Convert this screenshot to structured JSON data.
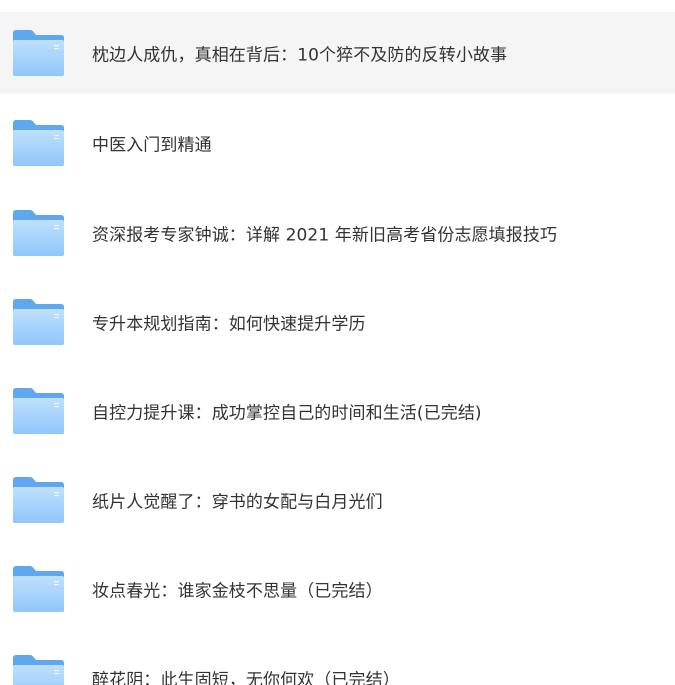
{
  "colors": {
    "folder_back": "#5fa7ee",
    "folder_front_top": "#bfe0fd",
    "folder_front_bottom": "#8fc6fa",
    "text": "#333333",
    "hover_bg": "#f5f5f6"
  },
  "files": [
    {
      "name": "枕边人成仇，真相在背后：10个猝不及防的反转小故事",
      "icon": "folder-icon",
      "hovered": true
    },
    {
      "name": "中医入门到精通",
      "icon": "folder-icon"
    },
    {
      "name": "资深报考专家钟诚：详解 2021 年新旧高考省份志愿填报技巧",
      "icon": "folder-icon"
    },
    {
      "name": "专升本规划指南：如何快速提升学历",
      "icon": "folder-icon"
    },
    {
      "name": "自控力提升课：成功掌控自己的时间和生活(已完结)",
      "icon": "folder-icon"
    },
    {
      "name": "纸片人觉醒了：穿书的女配与白月光们",
      "icon": "folder-icon"
    },
    {
      "name": "妆点春光：谁家金枝不思量（已完结）",
      "icon": "folder-icon"
    },
    {
      "name": "醉花阴：此生固短，无你何欢（已完结）",
      "icon": "folder-icon"
    }
  ]
}
